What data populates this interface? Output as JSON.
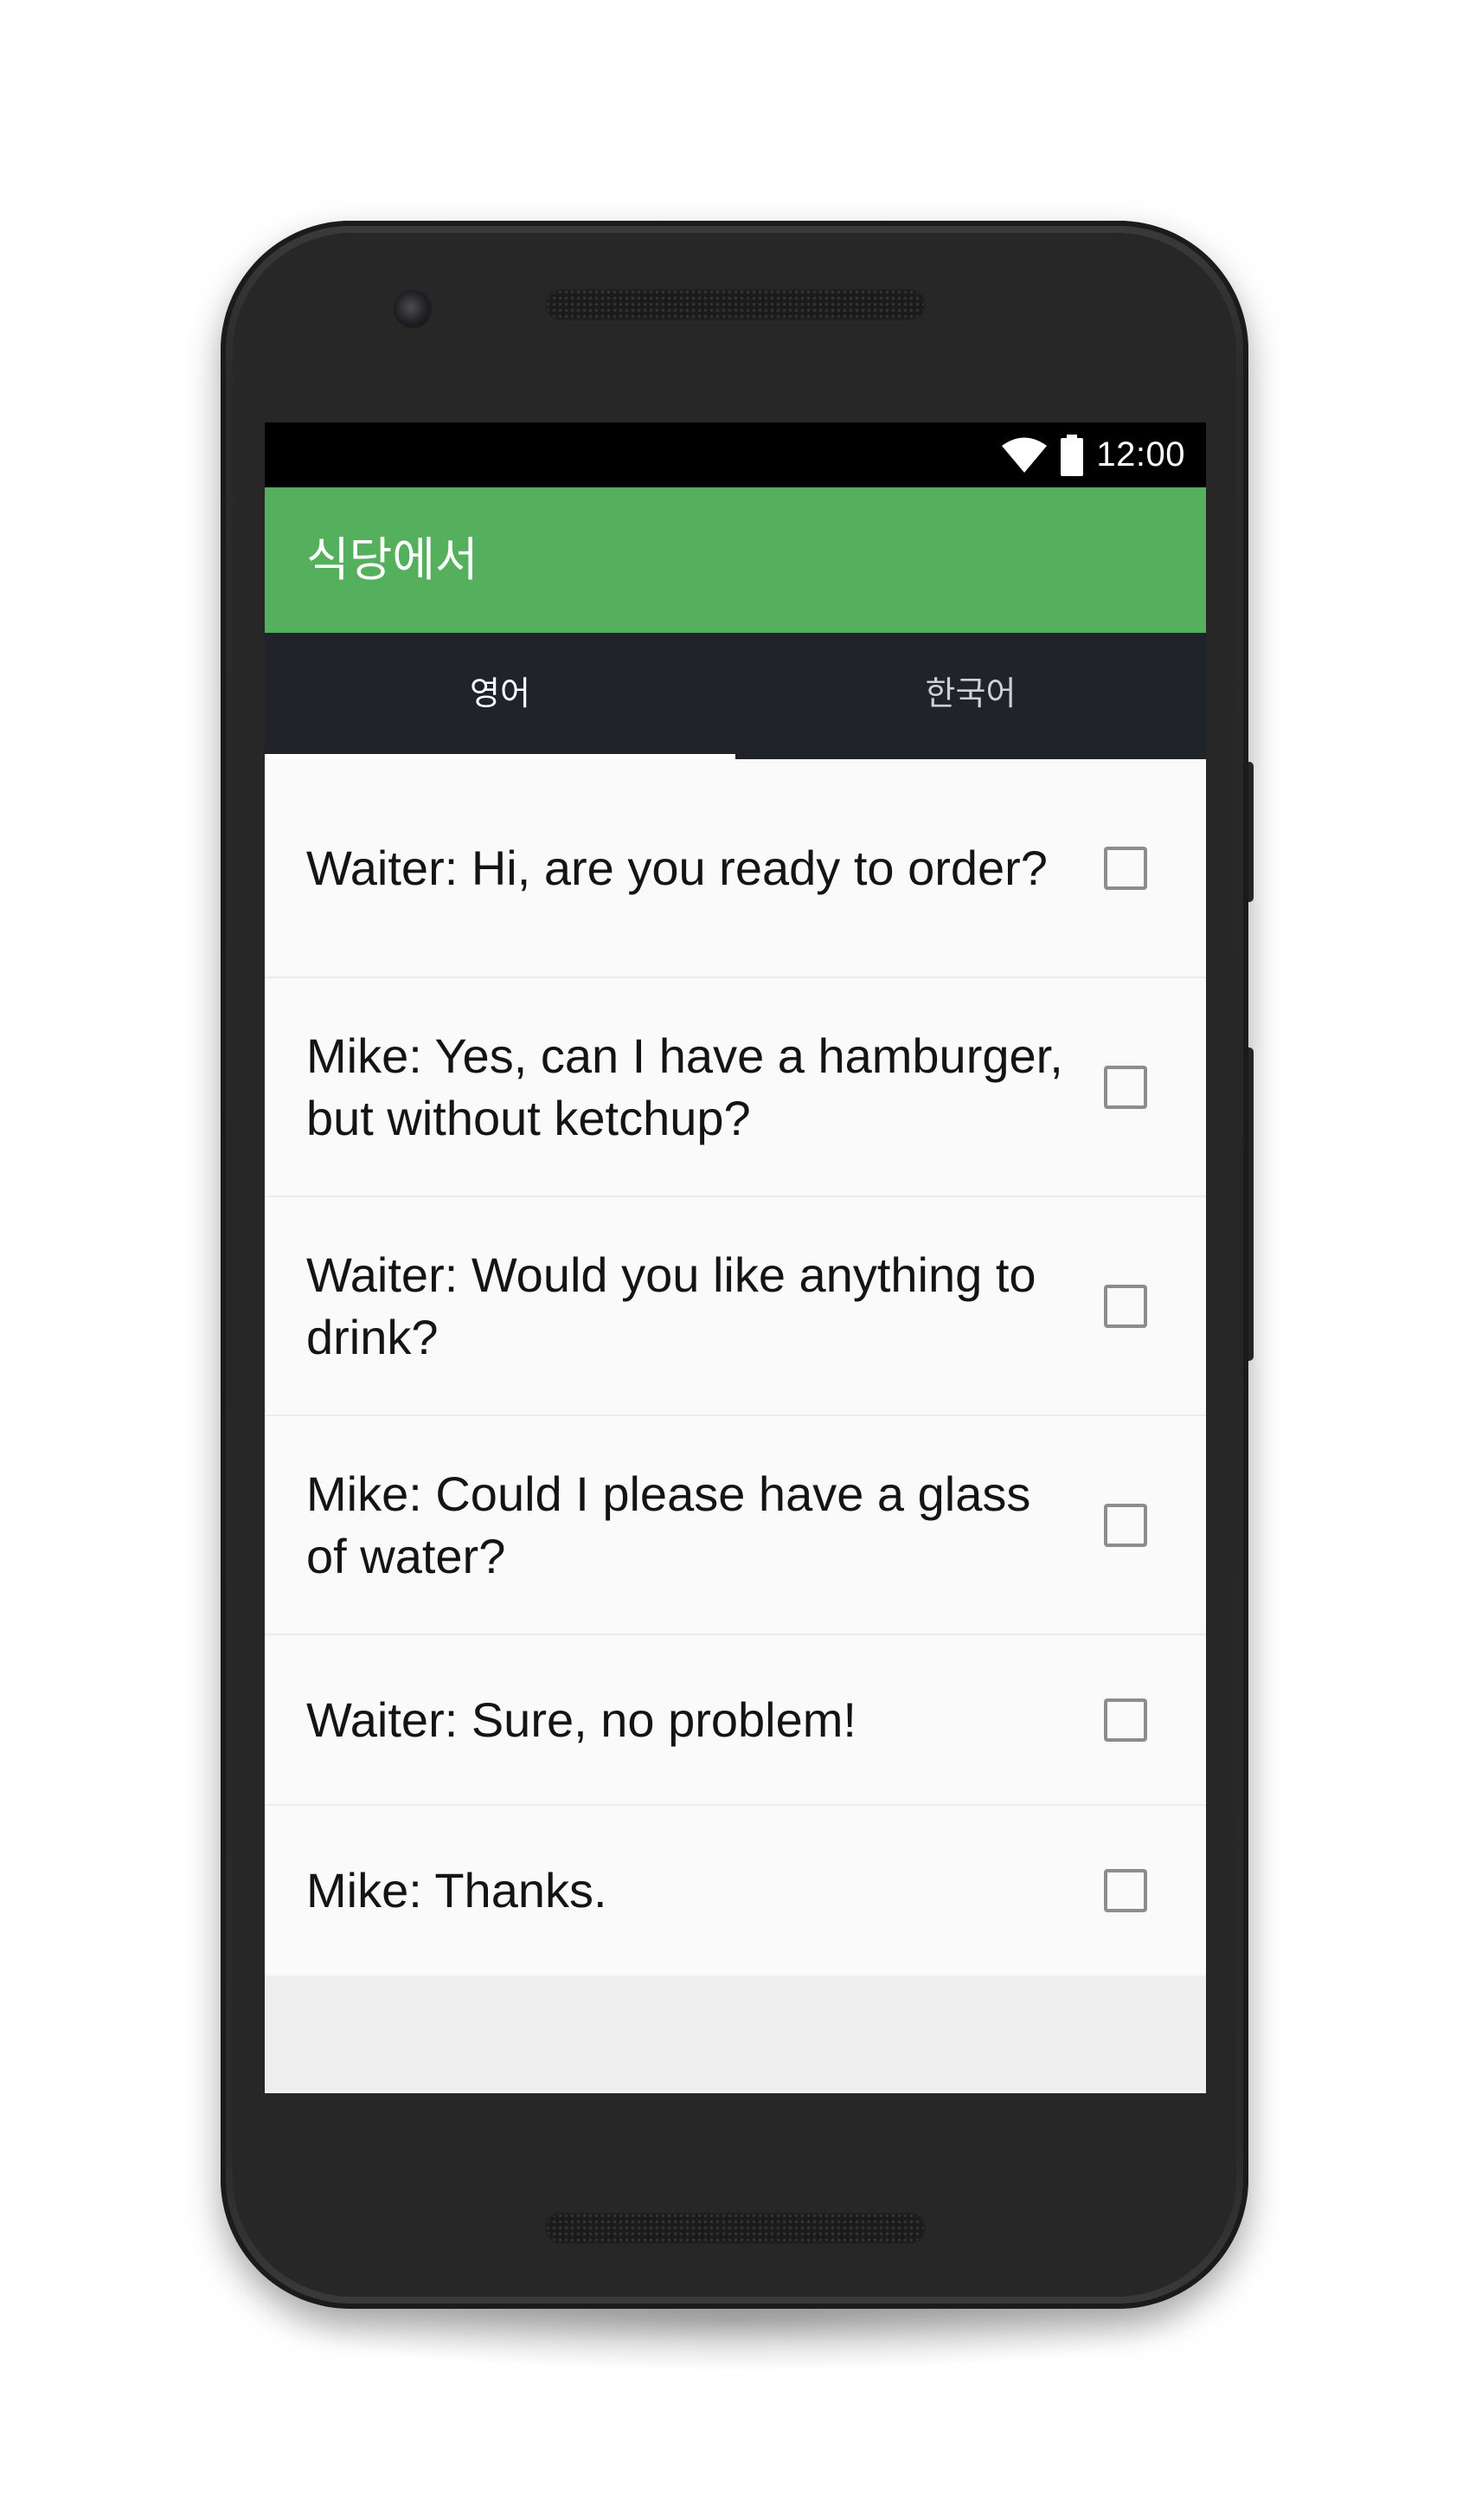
{
  "status_bar": {
    "time": "12:00",
    "icons": [
      "wifi-icon",
      "battery-icon"
    ]
  },
  "app_bar": {
    "title": "식당에서",
    "color": "#55b05d"
  },
  "tabs": [
    {
      "label": "영어",
      "selected": true
    },
    {
      "label": "한국어",
      "selected": false
    }
  ],
  "dialogue": [
    {
      "text": "Waiter: Hi, are you ready to order?",
      "checked": false
    },
    {
      "text": "Mike: Yes, can I have a hamburger, but without ketchup?",
      "checked": false
    },
    {
      "text": "Waiter: Would you like anything to drink?",
      "checked": false
    },
    {
      "text": "Mike: Could I please have a glass of water?",
      "checked": false
    },
    {
      "text": "Waiter: Sure, no problem!",
      "checked": false
    },
    {
      "text": "Mike: Thanks.",
      "checked": false
    }
  ]
}
